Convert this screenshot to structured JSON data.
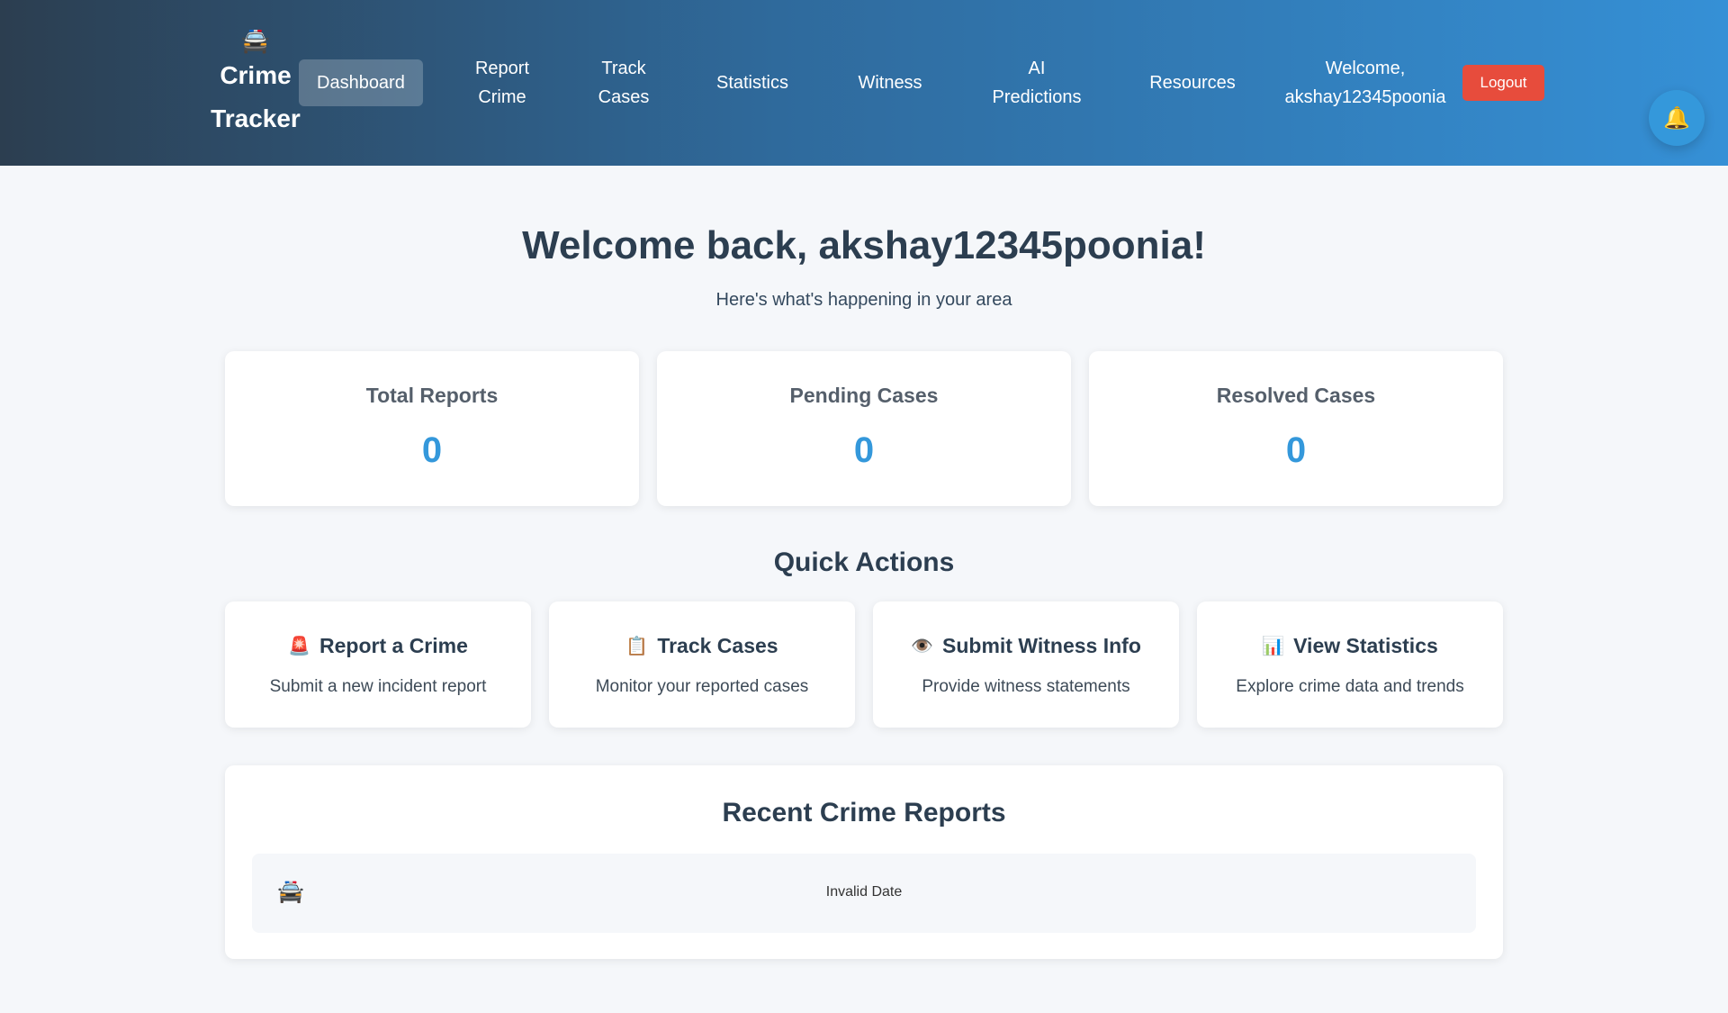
{
  "nav": {
    "brand_icon": "🚔",
    "brand_line1": "Crime",
    "brand_line2": "Tracker",
    "items": [
      {
        "line1": "Dashboard",
        "line2": ""
      },
      {
        "line1": "Report",
        "line2": "Crime"
      },
      {
        "line1": "Track",
        "line2": "Cases"
      },
      {
        "line1": "Statistics",
        "line2": ""
      },
      {
        "line1": "Witness",
        "line2": ""
      },
      {
        "line1": "AI",
        "line2": "Predictions"
      },
      {
        "line1": "Resources",
        "line2": ""
      }
    ],
    "active_item": "Dashboard",
    "welcome_line1": "Welcome,",
    "welcome_line2": "akshay12345poonia",
    "logout_label": "Logout",
    "bell_icon": "🔔"
  },
  "hero": {
    "title": "Welcome back, akshay12345poonia!",
    "subtitle": "Here's what's happening in your area"
  },
  "stats": [
    {
      "label": "Total Reports",
      "value": "0"
    },
    {
      "label": "Pending Cases",
      "value": "0"
    },
    {
      "label": "Resolved Cases",
      "value": "0"
    }
  ],
  "quick_actions": {
    "title": "Quick Actions",
    "items": [
      {
        "icon": "🚨",
        "title": "Report a Crime",
        "desc": "Submit a new incident report"
      },
      {
        "icon": "📋",
        "title": "Track Cases",
        "desc": "Monitor your reported cases"
      },
      {
        "icon": "👁️",
        "title": "Submit Witness Info",
        "desc": "Provide witness statements"
      },
      {
        "icon": "📊",
        "title": "View Statistics",
        "desc": "Explore crime data and trends"
      }
    ]
  },
  "recent": {
    "title": "Recent Crime Reports",
    "rows": [
      {
        "icon": "🚔",
        "date": "Invalid Date"
      }
    ]
  },
  "colors": {
    "accent": "#3498db",
    "logout": "#e74c3c",
    "heading": "#2c3e50"
  }
}
